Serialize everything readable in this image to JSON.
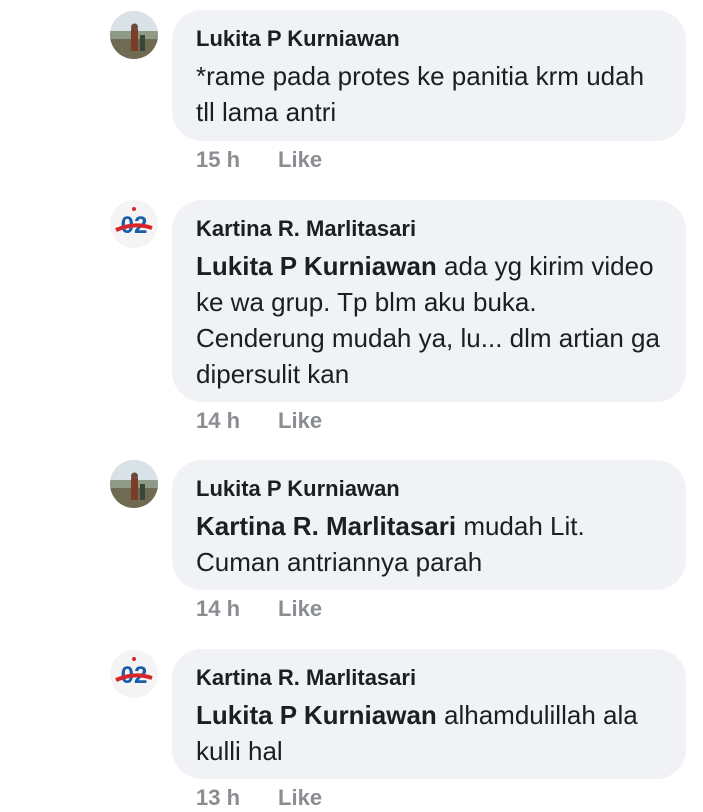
{
  "comments": [
    {
      "author": "Lukita P Kurniawan",
      "avatar": "landscape-photo-avatar",
      "mention": "",
      "text": "*rame pada protes ke panitia krm udah tll lama antri",
      "time": "15 h",
      "like_label": "Like"
    },
    {
      "author": "Kartina R. Marlitasari",
      "avatar": "02-logo-avatar",
      "mention": "Lukita P Kurniawan",
      "text": " ada yg kirim video ke wa grup. Tp blm aku buka. Cenderung mudah ya, lu... dlm artian ga dipersulit kan",
      "time": "14 h",
      "like_label": "Like"
    },
    {
      "author": "Lukita P Kurniawan",
      "avatar": "landscape-photo-avatar",
      "mention": "Kartina R. Marlitasari",
      "text": " mudah Lit. Cuman antriannya parah",
      "time": "14 h",
      "like_label": "Like"
    },
    {
      "author": "Kartina R. Marlitasari",
      "avatar": "02-logo-avatar",
      "mention": "Lukita P Kurniawan",
      "text": " alhamdulillah ala kulli hal",
      "time": "13 h",
      "like_label": "Like"
    }
  ],
  "avatar_logo_text": "02",
  "colors": {
    "bubble": "#f0f2f5",
    "meta": "#8a8d91",
    "text": "#1c1e21",
    "logo_blue": "#1b5ea8",
    "logo_red": "#d6262c"
  }
}
